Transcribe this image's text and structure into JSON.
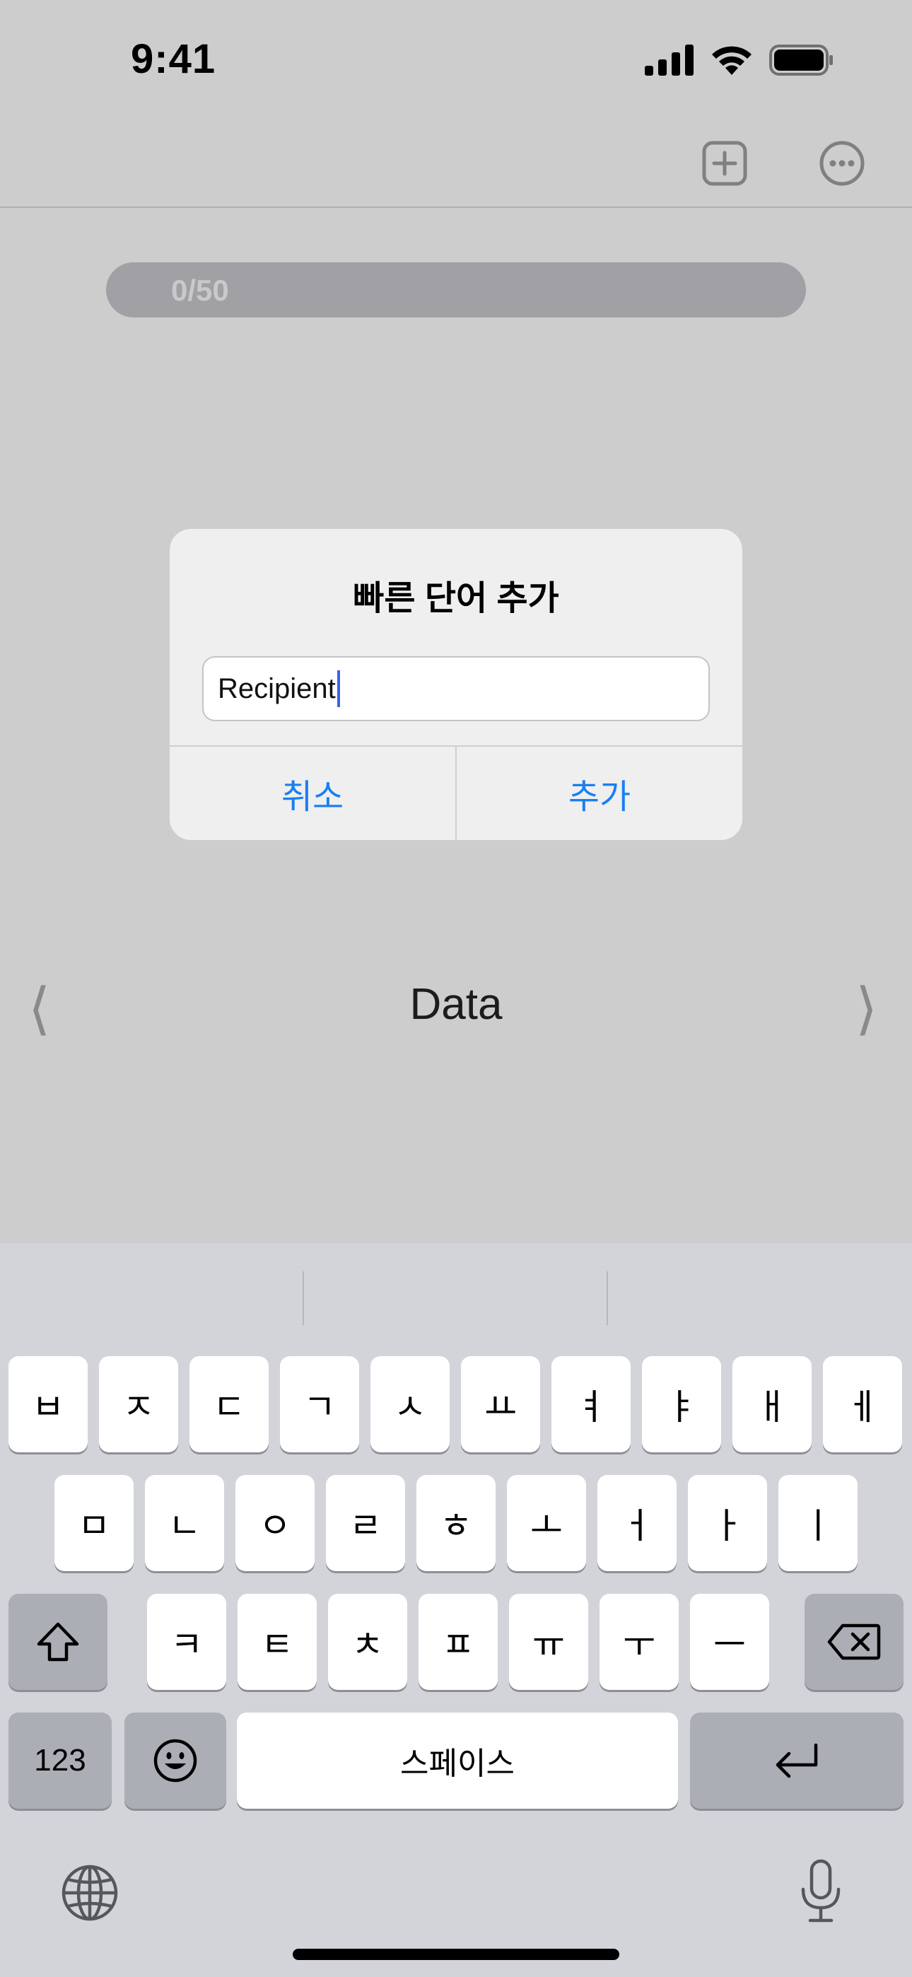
{
  "status_bar": {
    "time": "9:41"
  },
  "nav": {
    "add_icon": "plus-square-icon",
    "more_icon": "ellipsis-circle-icon"
  },
  "progress": {
    "label": "0/50",
    "value": 0,
    "total": 50
  },
  "word_nav": {
    "prev_glyph": "⟨",
    "next_glyph": "⟩",
    "current_word": "Data"
  },
  "alert": {
    "title": "빠른 단어 추가",
    "input_value": "Recipient",
    "cancel_label": "취소",
    "confirm_label": "추가"
  },
  "keyboard": {
    "row1": [
      "ㅂ",
      "ㅈ",
      "ㄷ",
      "ㄱ",
      "ㅅ",
      "ㅛ",
      "ㅕ",
      "ㅑ",
      "ㅐ",
      "ㅔ"
    ],
    "row2": [
      "ㅁ",
      "ㄴ",
      "ㅇ",
      "ㄹ",
      "ㅎ",
      "ㅗ",
      "ㅓ",
      "ㅏ",
      "ㅣ"
    ],
    "row3": [
      "ㅋ",
      "ㅌ",
      "ㅊ",
      "ㅍ",
      "ㅠ",
      "ㅜ",
      "ㅡ"
    ],
    "numbers_label": "123",
    "space_label": "스페이스",
    "shift_icon": "shift-icon",
    "delete_icon": "delete-icon",
    "emoji_icon": "emoji-icon",
    "return_icon": "return-icon",
    "globe_icon": "globe-icon",
    "mic_icon": "microphone-icon"
  },
  "colors": {
    "accent": "#1a7ff0",
    "caret": "#3b63e0"
  }
}
